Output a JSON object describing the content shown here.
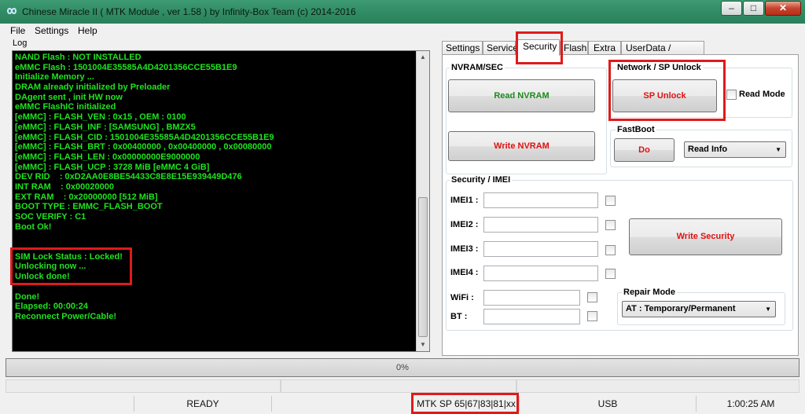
{
  "window": {
    "title": "Chinese Miracle II ( MTK Module , ver 1.58 ) by Infinity-Box Team (c) 2014-2016",
    "minimize_glyph": "–",
    "maximize_glyph": "□",
    "close_glyph": "✕"
  },
  "menu": {
    "file": "File",
    "settings": "Settings",
    "help": "Help"
  },
  "log": {
    "label": "Log",
    "lines": [
      "NAND Flash : NOT INSTALLED",
      "eMMC Flash : 1501004E35585A4D4201356CCE55B1E9",
      "Initialize Memory ...",
      "DRAM already initialized by Preloader",
      "DAgent sent , init HW now",
      "eMMC FlashIC initialized",
      "[eMMC] : FLASH_VEN : 0x15 , OEM : 0100",
      "[eMMC] : FLASH_INF : [SAMSUNG] , BMZX5",
      "[eMMC] : FLASH_CID : 1501004E35585A4D4201356CCE55B1E9",
      "[eMMC] : FLASH_BRT : 0x00400000 , 0x00400000 , 0x00080000",
      "[eMMC] : FLASH_LEN : 0x00000000E9000000",
      "[eMMC] : FLASH_UCP : 3728 MiB [eMMC 4 GiB]",
      "DEV RID    : 0xD2AA0E8BE54433C8E8E15E939449D476",
      "INT RAM    : 0x00020000",
      "EXT RAM    : 0x20000000 [512 MiB]",
      "BOOT TYPE : EMMC_FLASH_BOOT",
      "SOC VERIFY : C1",
      "Boot Ok!",
      "",
      "",
      "SIM Lock Status : Locked!",
      "Unlocking now ...",
      "Unlock done!",
      "",
      "Done!",
      "Elapsed: 00:00:24",
      "Reconnect Power/Cable!"
    ]
  },
  "tabs": [
    {
      "label": "Settings"
    },
    {
      "label": "Service"
    },
    {
      "label": "Security"
    },
    {
      "label": "Flash"
    },
    {
      "label": "Extra"
    },
    {
      "label": "UserData / Forensic"
    }
  ],
  "active_tab": "Security",
  "nvram": {
    "title": "NVRAM/SEC",
    "read": "Read NVRAM",
    "write": "Write NVRAM"
  },
  "network": {
    "title": "Network / SP Unlock",
    "unlock": "SP Unlock",
    "read_mode": "Read Mode"
  },
  "fastboot": {
    "title": "FastBoot",
    "do": "Do",
    "selected": "Read Info"
  },
  "security": {
    "title": "Security / IMEI",
    "imei1": "IMEI1 :",
    "imei2": "IMEI2 :",
    "imei3": "IMEI3 :",
    "imei4": "IMEI4 :",
    "wifi": "WiFi :",
    "bt": "BT :",
    "write": "Write Security"
  },
  "repair": {
    "title": "Repair Mode",
    "selected": "AT : Temporary/Permanent"
  },
  "progress": {
    "text": "0%",
    "value": 0
  },
  "status": {
    "state": "READY",
    "platform": "MTK SP 65|67|83|81|xx",
    "port": "USB",
    "time": "1:00:25 AM"
  },
  "colors": {
    "log_text": "#1fe31f",
    "highlight": "#e01a1a",
    "green_button": "#1b8a1b",
    "red_button": "#e01010"
  }
}
